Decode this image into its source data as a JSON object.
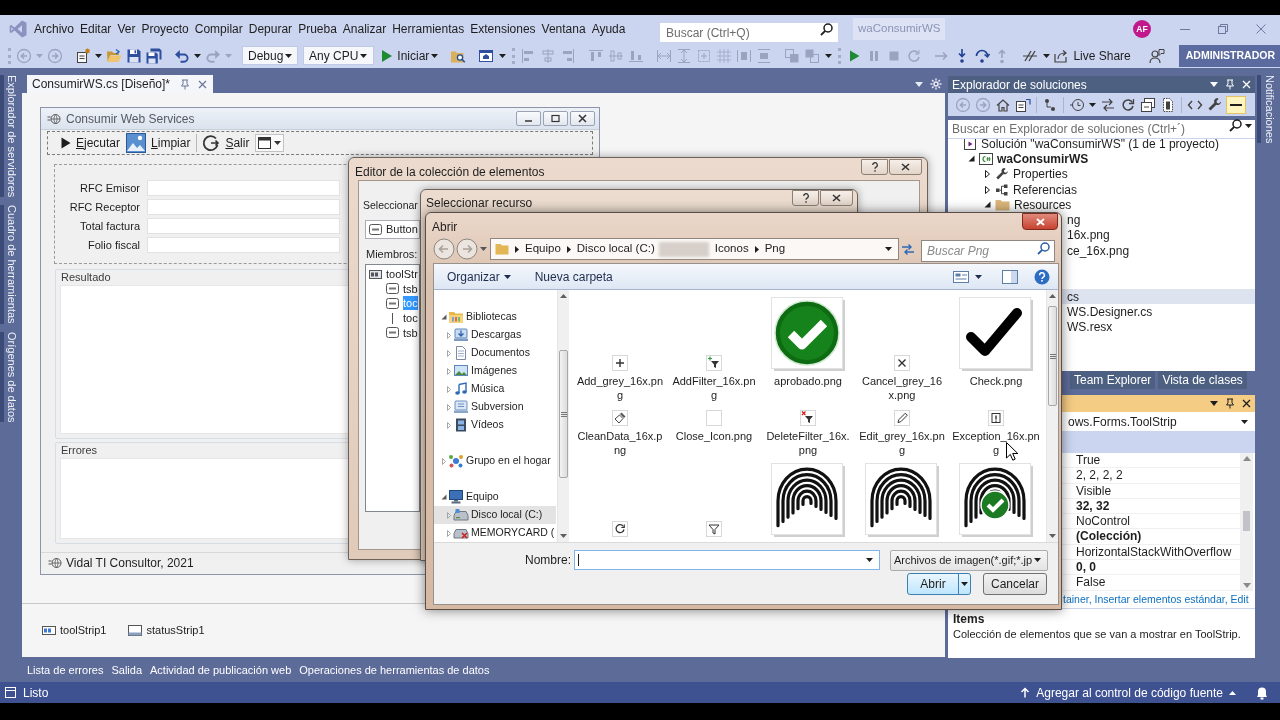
{
  "menu_bar": {
    "items": [
      "Archivo",
      "Editar",
      "Ver",
      "Proyecto",
      "Compilar",
      "Depurar",
      "Prueba",
      "Analizar",
      "Herramientas",
      "Extensiones",
      "Ventana",
      "Ayuda"
    ],
    "search": {
      "placeholder": "Buscar (Ctrl+Q)"
    },
    "solution_name": "waConsumirWS",
    "avatar": "AF"
  },
  "toolbar": {
    "configuration": "Debug",
    "platform": "Any CPU",
    "start": "Iniciar",
    "live_share": "Live Share",
    "account_badge": "ADMINISTRADOR"
  },
  "left_side_tabs": [
    "Explorador de servidores",
    "Cuadro de herramientas",
    "Orígenes de datos"
  ],
  "right_side_tabs": [
    "Notificaciones"
  ],
  "document_tabs": [
    {
      "title": "ConsumirWS.cs [Diseño]*",
      "selected": true
    }
  ],
  "designer": {
    "form": {
      "title": "Consumir Web Services",
      "toolstrip": [
        {
          "kind": "button",
          "label": "Ejecutar"
        },
        {
          "kind": "button",
          "label": "Limpiar"
        },
        {
          "kind": "separator"
        },
        {
          "kind": "button",
          "label": "Salir"
        },
        {
          "kind": "dropdown"
        }
      ],
      "fields": [
        {
          "label": "RFC Emisor"
        },
        {
          "label": "RFC Receptor"
        },
        {
          "label": "Total factura"
        },
        {
          "label": "Folio fiscal"
        }
      ],
      "groups": [
        {
          "title": "Resultado"
        },
        {
          "title": "Errores"
        }
      ],
      "status": "Vidal TI Consultor, 2021"
    },
    "component_tray": [
      "toolStrip1",
      "statusStrip1"
    ]
  },
  "collection_editor": {
    "title": "Editor de la colección de elementos",
    "select_label": "Seleccionar",
    "item_type": "Button",
    "members_label": "Miembros:",
    "members": [
      {
        "label": "toolStr",
        "kind": "strip",
        "selected": false,
        "children": [
          {
            "label": "tsb",
            "kind": "button",
            "selected": false
          },
          {
            "label": "toc",
            "kind": "button",
            "selected": true
          },
          {
            "label": "toc",
            "kind": "separator",
            "selected": false
          },
          {
            "label": "tsb",
            "kind": "button",
            "selected": false
          }
        ]
      }
    ]
  },
  "resource_dialog": {
    "title": "Seleccionar recurso"
  },
  "open_dialog": {
    "title": "Abrir",
    "path": [
      {
        "kind": "folder",
        "label": "Equipo"
      },
      {
        "kind": "folder",
        "label": "Disco local (C:)"
      },
      {
        "kind": "redacted"
      },
      {
        "kind": "folder",
        "label": "Iconos"
      },
      {
        "kind": "folder",
        "label": "Png"
      }
    ],
    "search": {
      "placeholder": "Buscar Png"
    },
    "commands": [
      {
        "label": "Organizar",
        "menu": true
      },
      {
        "label": "Nueva carpeta",
        "menu": false
      }
    ],
    "navigation": [
      {
        "label": "Bibliotecas",
        "expanded": true,
        "selected": false,
        "children": [
          {
            "label": "Descargas",
            "expanded": false,
            "selected": false
          },
          {
            "label": "Documentos",
            "expanded": false,
            "selected": false
          },
          {
            "label": "Imágenes",
            "expanded": false,
            "selected": false
          },
          {
            "label": "Música",
            "expanded": false,
            "selected": false
          },
          {
            "label": "Subversion",
            "expanded": false,
            "selected": false
          },
          {
            "label": "Vídeos",
            "expanded": false,
            "selected": false
          }
        ]
      },
      {
        "label": "Grupo en el hogar",
        "expanded": false,
        "selected": false
      },
      {
        "label": "Equipo",
        "expanded": true,
        "selected": false,
        "children": [
          {
            "label": "Disco local (C:)",
            "expanded": false,
            "selected": true
          },
          {
            "label": "MEMORYCARD (",
            "expanded": false,
            "selected": false
          }
        ]
      }
    ],
    "files": [
      {
        "name": "Add_grey_16x.png",
        "kind": "icon"
      },
      {
        "name": "AddFilter_16x.png",
        "kind": "icon"
      },
      {
        "name": "aprobado.png",
        "kind": "thumbnail"
      },
      {
        "name": "Cancel_grey_16x.png",
        "kind": "icon"
      },
      {
        "name": "Check.png",
        "kind": "thumbnail"
      },
      {
        "name": "CleanData_16x.png",
        "kind": "icon"
      },
      {
        "name": "Close_Icon.png",
        "kind": "icon"
      },
      {
        "name": "DeleteFilter_16x.png",
        "kind": "icon"
      },
      {
        "name": "Edit_grey_16x.png",
        "kind": "icon"
      },
      {
        "name": "Exception_16x.png",
        "kind": "icon"
      },
      {
        "kind": "icon"
      },
      {
        "kind": "icon"
      },
      {
        "kind": "thumbnail"
      },
      {
        "kind": "thumbnail"
      },
      {
        "kind": "thumbnail"
      }
    ],
    "filename_label": "Nombre:",
    "file_type": "Archivos de imagen(*.gif;*.jp",
    "buttons": [
      {
        "label": "Abrir",
        "split": true,
        "default": true
      },
      {
        "label": "Cancelar",
        "split": false,
        "default": false
      }
    ]
  },
  "solution_explorer": {
    "title": "Explorador de soluciones",
    "active": false,
    "search": {
      "placeholder": "Buscar en Explorador de soluciones (Ctrl+´)"
    },
    "tree": [
      {
        "label": "Solución \"waConsumirWS\" (1 de 1 proyecto)",
        "kind": "solution",
        "selected": false,
        "children": [
          {
            "label": "waConsumirWS",
            "kind": "project",
            "expanded": true,
            "selected": false,
            "children": [
              {
                "label": "Properties",
                "kind": "properties",
                "expanded": false,
                "selected": false
              },
              {
                "label": "Referencias",
                "kind": "references",
                "expanded": false,
                "selected": false
              },
              {
                "label": "Resources",
                "kind": "folder",
                "expanded": true,
                "selected": false,
                "children": [
                  {
                    "label": "ng",
                    "selected": false
                  },
                  {
                    "label": "16x.png",
                    "selected": false
                  },
                  {
                    "label": "ce_16x.png",
                    "selected": false
                  }
                ]
              },
              {
                "label": "cs",
                "selected": true,
                "children": [
                  {
                    "label": "WS.Designer.cs",
                    "selected": false
                  },
                  {
                    "label": "WS.resx",
                    "selected": false
                  }
                ]
              }
            ]
          }
        ]
      }
    ],
    "tabs": [
      {
        "label": "Team Explorer",
        "selected": false
      },
      {
        "label": "Vista de clases",
        "selected": false
      }
    ]
  },
  "properties": {
    "active": true,
    "object": "ows.Forms.ToolStrip",
    "values": [
      {
        "value": "True",
        "modified": false
      },
      {
        "value": "2, 2, 2, 2",
        "modified": false
      },
      {
        "value": "Visible",
        "modified": false
      },
      {
        "value": "32, 32",
        "modified": true
      },
      {
        "value": "NoControl",
        "modified": false
      },
      {
        "value": "(Colección)",
        "modified": true
      },
      {
        "value": "HorizontalStackWithOverflow",
        "modified": false
      },
      {
        "value": "0, 0",
        "modified": true
      },
      {
        "value": "False",
        "modified": false
      }
    ],
    "commands": "tainer, Insertar elementos estándar, Edit",
    "description": {
      "title": "Items",
      "text": "Colección de elementos que se van a mostrar en ToolStrip."
    }
  },
  "bottom_tabs": [
    "Lista de errores",
    "Salida",
    "Actividad de publicación web",
    "Operaciones de herramientas de datos"
  ],
  "status_bar": {
    "text": "Listo",
    "source_control": "Agregar al control de código fuente"
  }
}
